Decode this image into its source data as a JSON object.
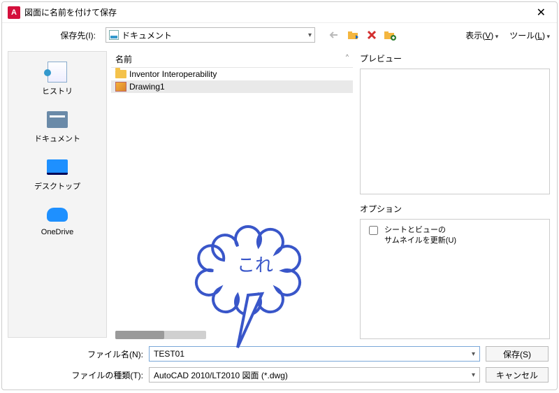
{
  "title": "図面に名前を付けて保存",
  "toolbar": {
    "savein_label": "保存先(I):",
    "location": "ドキュメント",
    "view_label": "表示",
    "view_accel": "V",
    "tools_label": "ツール",
    "tools_accel": "L"
  },
  "sidebar": {
    "items": [
      {
        "label": "ヒストリ"
      },
      {
        "label": "ドキュメント"
      },
      {
        "label": "デスクトップ"
      },
      {
        "label": "OneDrive"
      }
    ]
  },
  "filelist": {
    "col_name": "名前",
    "rows": [
      {
        "name": "Inventor Interoperability",
        "type": "folder"
      },
      {
        "name": "Drawing1",
        "type": "dwg",
        "selected": true
      }
    ]
  },
  "preview": {
    "title": "プレビュー"
  },
  "options": {
    "title": "オプション",
    "thumb_label": "シートとビューの\nサムネイルを更新(U)",
    "thumb_checked": false
  },
  "footer": {
    "filename_label": "ファイル名(N):",
    "filename_value": "TEST01",
    "filetype_label": "ファイルの種類(T):",
    "filetype_value": "AutoCAD 2010/LT2010 図面 (*.dwg)",
    "save_label": "保存(S)",
    "cancel_label": "キャンセル"
  },
  "annotation": {
    "text": "これ"
  }
}
